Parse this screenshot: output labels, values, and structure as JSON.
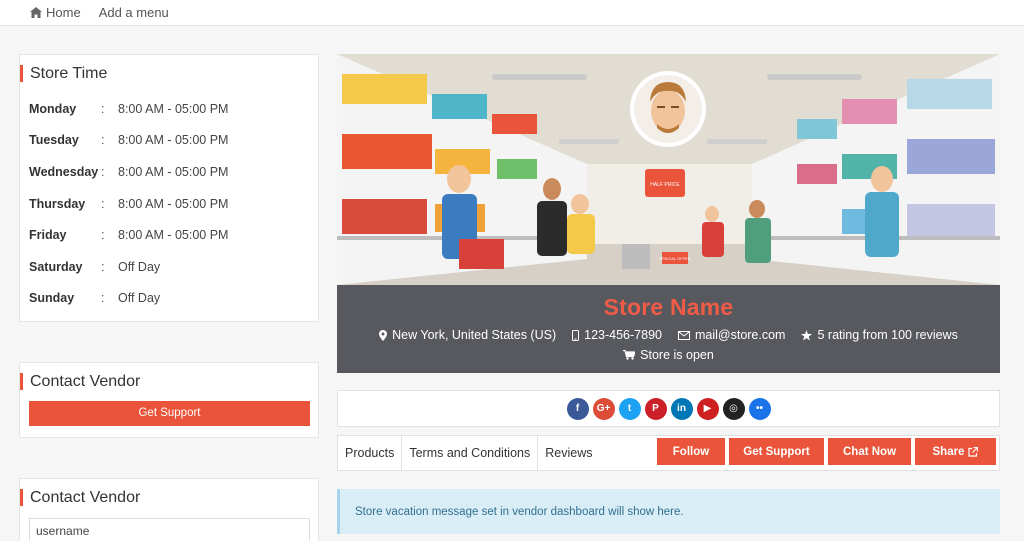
{
  "topnav": {
    "home": "Home",
    "add_menu": "Add a menu"
  },
  "store_time": {
    "title": "Store Time",
    "separator": ":",
    "rows": [
      {
        "day": "Monday",
        "hours": "8:00 AM - 05:00 PM"
      },
      {
        "day": "Tuesday",
        "hours": "8:00 AM - 05:00 PM"
      },
      {
        "day": "Wednesday",
        "hours": "8:00 AM - 05:00 PM"
      },
      {
        "day": "Thursday",
        "hours": "8:00 AM - 05:00 PM"
      },
      {
        "day": "Friday",
        "hours": "8:00 AM - 05:00 PM"
      },
      {
        "day": "Saturday",
        "hours": "Off Day"
      },
      {
        "day": "Sunday",
        "hours": "Off Day"
      }
    ]
  },
  "contact_vendor_1": {
    "title": "Contact Vendor",
    "button": "Get Support"
  },
  "contact_vendor_2": {
    "title": "Contact Vendor",
    "username_value": "username"
  },
  "banner": {
    "store_name": "Store Name",
    "location": "New York, United States (US)",
    "phone": "123-456-7890",
    "email": "mail@store.com",
    "rating": "5 rating from 100 reviews",
    "status": "Store is open",
    "sign_text": "HALF PRICE",
    "sale_text": "SPECIAL OFFER"
  },
  "socials": [
    {
      "name": "facebook",
      "glyph": "f",
      "color": "#3b5998"
    },
    {
      "name": "google-plus",
      "glyph": "G+",
      "color": "#dd4b39"
    },
    {
      "name": "twitter",
      "glyph": "t",
      "color": "#1da1f2"
    },
    {
      "name": "pinterest",
      "glyph": "P",
      "color": "#cb2027"
    },
    {
      "name": "linkedin",
      "glyph": "in",
      "color": "#0077b5"
    },
    {
      "name": "youtube",
      "glyph": "▶",
      "color": "#cd201f"
    },
    {
      "name": "instagram",
      "glyph": "◎",
      "color": "#222222"
    },
    {
      "name": "flickr",
      "glyph": "••",
      "color": "#1a73e8"
    }
  ],
  "tabs": {
    "products": "Products",
    "terms": "Terms and Conditions",
    "reviews": "Reviews"
  },
  "actions": {
    "follow": "Follow",
    "support": "Get Support",
    "chat": "Chat Now",
    "share": "Share"
  },
  "vacation_message": "Store vacation message set in vendor dashboard will show here.",
  "colors": {
    "accent": "#e9543a",
    "store_name": "#f05b47",
    "banner_info_bg": "#57595e",
    "vacation_bg": "#d9edf7"
  }
}
